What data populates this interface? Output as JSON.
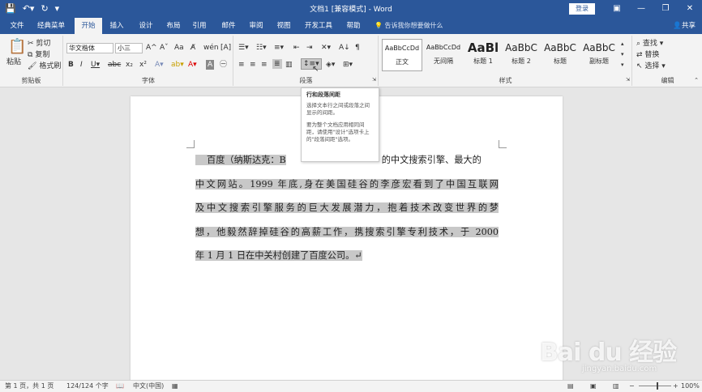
{
  "titlebar": {
    "title": "文档1 [兼容模式] - Word",
    "login": "登录",
    "qat_icons": [
      "save-icon",
      "undo-icon",
      "redo-icon",
      "customize-icon"
    ],
    "colors": {
      "brand": "#2b579a"
    }
  },
  "tabs": [
    "文件",
    "经典菜单",
    "开始",
    "插入",
    "设计",
    "布局",
    "引用",
    "邮件",
    "审阅",
    "视图",
    "开发工具",
    "帮助"
  ],
  "active_tab": "开始",
  "tell_me": "告诉我你想要做什么",
  "share": "共享",
  "clipboard": {
    "paste": "粘贴",
    "cut": "剪切",
    "copy": "复制",
    "format_painter": "格式刷",
    "label": "剪贴板"
  },
  "font": {
    "name": "华文楷体",
    "size": "小三",
    "label": "字体"
  },
  "paragraph": {
    "label": "段落"
  },
  "styles": {
    "label": "样式",
    "items": [
      {
        "sample": "AaBbCcDd",
        "name": "正文"
      },
      {
        "sample": "AaBbCcDd",
        "name": "无间隔"
      },
      {
        "sample": "AaBl",
        "name": "标题 1"
      },
      {
        "sample": "AaBbC",
        "name": "标题 2"
      },
      {
        "sample": "AaBbC",
        "name": "标题"
      },
      {
        "sample": "AaBbC",
        "name": "副标题"
      }
    ]
  },
  "editing": {
    "find": "查找",
    "replace": "替换",
    "select": "选择",
    "label": "编辑"
  },
  "tooltip": {
    "title": "行和段落间距",
    "text1": "选择文本行之间或段落之间显示的间距。",
    "text2": "要为整个文档应用相同间距，请使用\"设计\"选项卡上的\"段落间距\"选项。"
  },
  "document": {
    "lines": [
      "百度（纳斯达克：B",
      "中文网站。1999 年底,身在美国硅谷的李彦宏看到了中国互联网",
      "及中文搜索引擎服务的巨大发展潜力，抱着技术改变世界的梦",
      "想，他毅然辞掉硅谷的高薪工作，携搜索引擎专利技术，于 2000",
      "年 1 月 1 日在中关村创建了百度公司。↵"
    ],
    "line1_tail": "的中文搜索引擎、最大的"
  },
  "status": {
    "page": "第 1 页，共 1 页",
    "words": "124/124 个字",
    "lang": "中文(中国)",
    "zoom": "100%"
  },
  "watermark": {
    "logo": "Bai du 经验",
    "url": "jingyan.baidu.com"
  }
}
